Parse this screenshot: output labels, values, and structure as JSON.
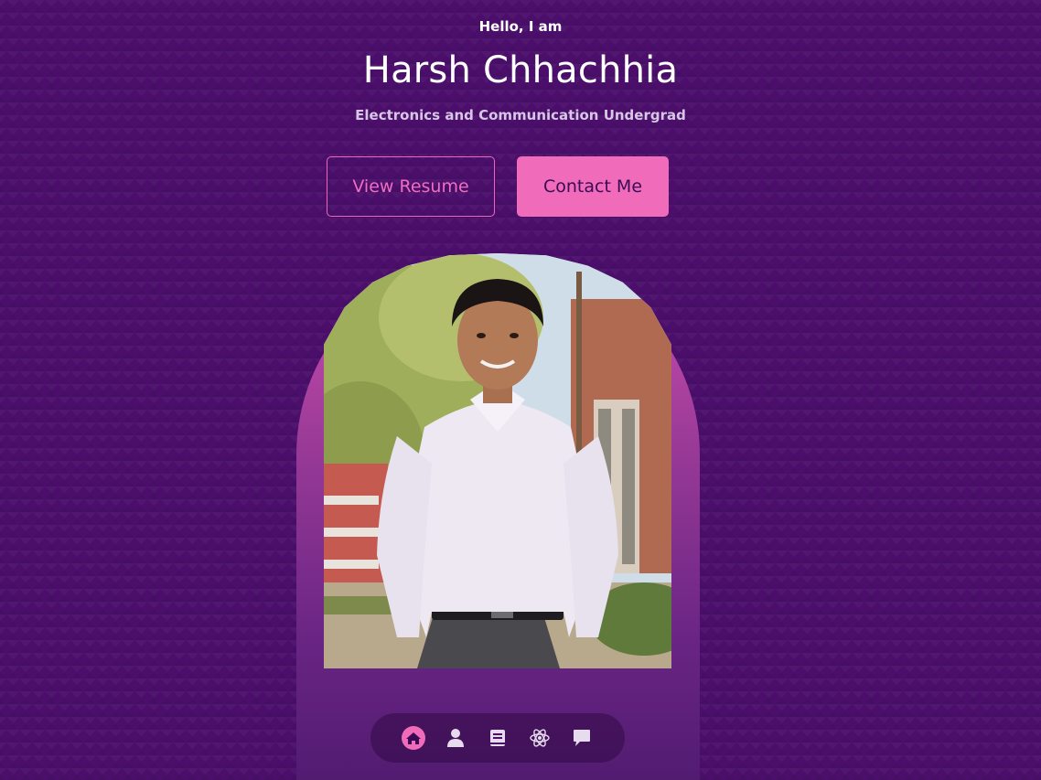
{
  "hero": {
    "greeting": "Hello, I am",
    "name": "Harsh Chhachhia",
    "subtitle": "Electronics and Communication Undergrad"
  },
  "buttons": {
    "resume_label": "View Resume",
    "contact_label": "Contact Me"
  },
  "photo": {
    "alt": "Portrait of Harsh Chhachhia"
  },
  "nav": {
    "items": [
      {
        "icon": "home-icon",
        "active": true
      },
      {
        "icon": "user-icon",
        "active": false
      },
      {
        "icon": "book-icon",
        "active": false
      },
      {
        "icon": "react-icon",
        "active": false
      },
      {
        "icon": "chat-icon",
        "active": false
      }
    ]
  },
  "colors": {
    "background": "#4b0f6b",
    "accent": "#f06cba",
    "arch_top": "#cf4fb0",
    "nav_inactive": "#e6dcee"
  }
}
